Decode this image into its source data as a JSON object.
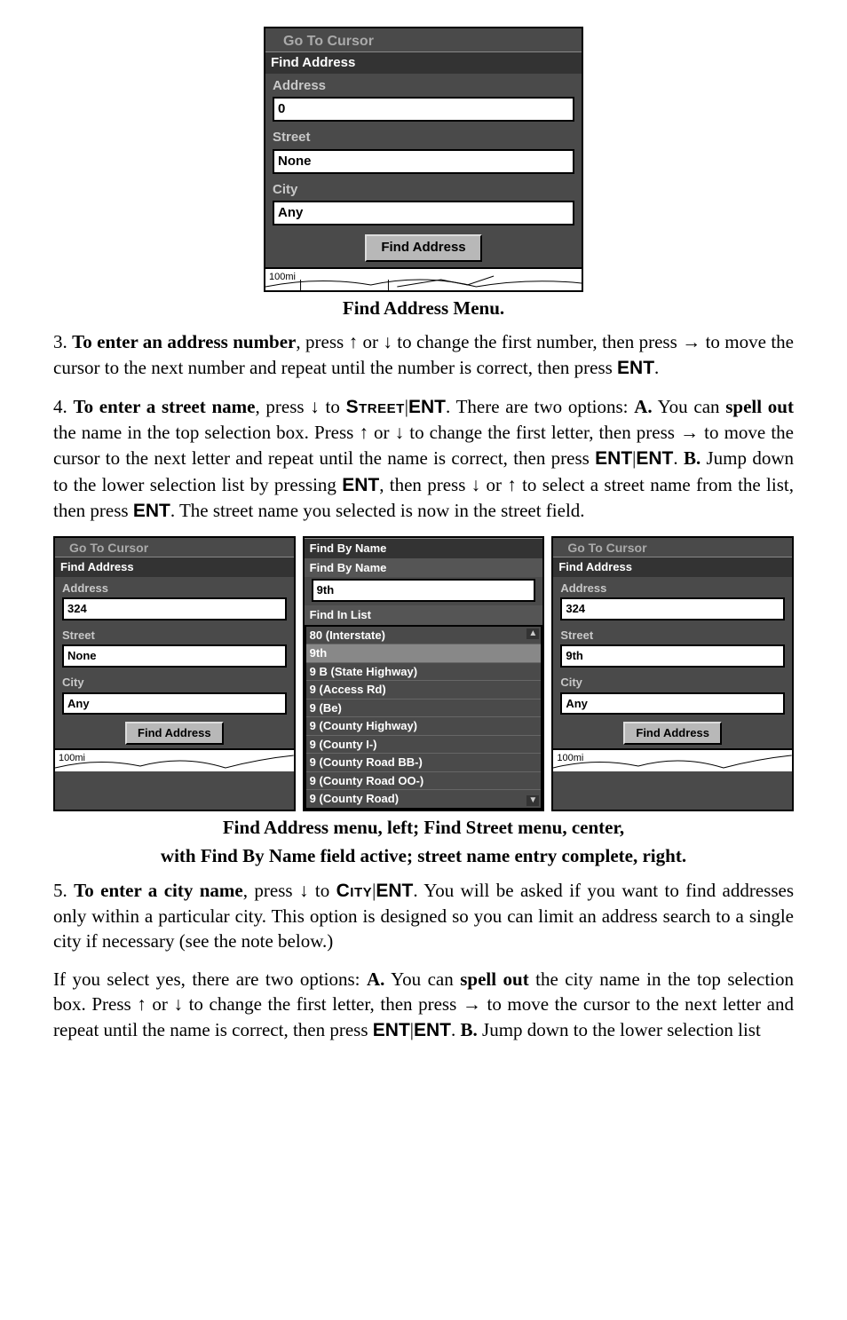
{
  "figure1": {
    "ghost_title": "Go To Cursor",
    "panel_title": "Find Address",
    "address_label": "Address",
    "address_value": "0",
    "street_label": "Street",
    "street_value": "None",
    "city_label": "City",
    "city_value": "Any",
    "button_label": "Find Address",
    "scale": "100mi"
  },
  "caption1": "Find Address Menu.",
  "para1": {
    "lead": "3. ",
    "bold": "To enter an address number",
    "text1": ", press ",
    "arrow_up": "↑",
    "text2": " or ",
    "arrow_down": "↓",
    "text3": " to change the first number, then press ",
    "arrow_right": "→",
    "text4": " to move the cursor to the next number and repeat until the number is correct, then press ",
    "ent": "ENT",
    "text5": "."
  },
  "para2": {
    "lead": "4. ",
    "bold": "To enter a street name",
    "t1": ", press ",
    "arrow_down": "↓",
    "t2": " to ",
    "street": "Street",
    "pipe": "|",
    "ent": "ENT",
    "t3": ". There are two options: ",
    "a": "A.",
    "t4": " You can ",
    "spell": "spell out",
    "t5": " the name in the top selection box. Press ",
    "arrow_up": "↑",
    "t6": " or ",
    "arrow_down2": "↓",
    "t7": " to change the first letter, then press ",
    "arrow_right": "→",
    "t8": " to move the cursor to the next letter and repeat until the name is correct, then press ",
    "ent2a": "ENT",
    "pipe2": "|",
    "ent2b": "ENT",
    "t9": ". ",
    "b": "B.",
    "t10": " Jump down to the lower selection list by pressing ",
    "ent3": "ENT",
    "t11": ", then press ",
    "arrow_down3": "↓",
    "t12": " or ",
    "arrow_up2": "↑",
    "t13": " to select a street name from the list, then press ",
    "ent4": "ENT",
    "t14": ". The street name you selected is now in the street field."
  },
  "figure2": {
    "left": {
      "ghost_title": "Go To Cursor",
      "panel_title": "Find Address",
      "address_label": "Address",
      "address_value": "324",
      "street_label": "Street",
      "street_value": "None",
      "city_label": "City",
      "city_value": "Any",
      "button_label": "Find Address",
      "scale": "100mi"
    },
    "center": {
      "panel_title": "Find By Name",
      "sub_title": "Find By Name",
      "name_value": "9th",
      "list_label": "Find In List",
      "items": [
        "80 (Interstate)",
        "9th",
        "9   B (State Highway)",
        "9 (Access Rd)",
        "9 (Be)",
        "9 (County Highway)",
        "9 (County I-)",
        "9 (County Road BB-)",
        "9 (County Road OO-)",
        "9 (County Road)"
      ]
    },
    "right": {
      "ghost_title": "Go To Cursor",
      "panel_title": "Find Address",
      "address_label": "Address",
      "address_value": "324",
      "street_label": "Street",
      "street_value": "9th",
      "city_label": "City",
      "city_value": "Any",
      "button_label": "Find Address",
      "scale": "100mi"
    }
  },
  "caption2_line1": "Find Address menu, left; Find Street menu, center,",
  "caption2_line2": "with Find By Name field active; street name entry complete, right.",
  "para3": {
    "lead": "5. ",
    "bold": "To enter a city name",
    "t1": ", press ",
    "arrow_down": "↓",
    "t2": " to ",
    "city": "City",
    "pipe": "|",
    "ent": "ENT",
    "t3": ". You will be asked if you want to find addresses only within a particular city. This option is designed so you can limit an address search to a single city if necessary (see the note below.)"
  },
  "para4": {
    "t1": "If you select yes, there are two options: ",
    "a": "A.",
    "t2": " You can ",
    "spell": "spell out",
    "t3": " the city name in the top selection box. Press ",
    "arrow_up": "↑",
    "t4": " or ",
    "arrow_down": "↓",
    "t5": " to change the first letter, then press ",
    "arrow_right": "→",
    "t6": " to move the cursor to the next letter and repeat until the name is correct, then press ",
    "ent1a": "ENT",
    "pipe": "|",
    "ent1b": "ENT",
    "t7": ". ",
    "b": "B.",
    "t8": " Jump down to the lower selection list"
  }
}
